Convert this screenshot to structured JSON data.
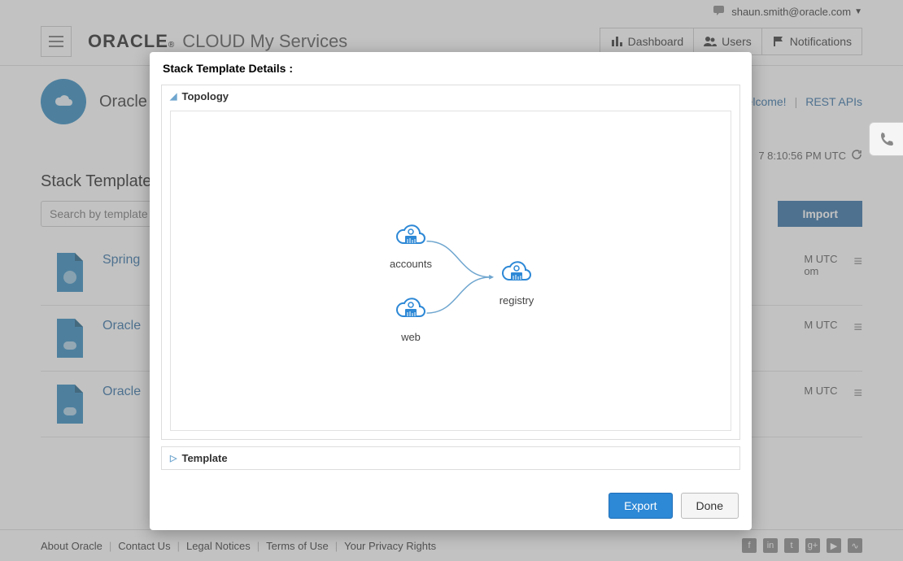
{
  "header": {
    "user_email": "shaun.smith@oracle.com",
    "brand_name": "ORACLE",
    "brand_suffix": "CLOUD My Services",
    "nav": {
      "dashboard": "Dashboard",
      "users": "Users",
      "notifications": "Notifications"
    }
  },
  "page": {
    "badge_title": "Oracle",
    "welcome": "elcome!",
    "rest_apis": "REST APIs",
    "timestamp": "7 8:10:56 PM UTC",
    "section_title": "Stack Templates",
    "search_placeholder": "Search by template n",
    "import_label": "Import"
  },
  "templates": [
    {
      "name": "Spring",
      "meta_line1": "M UTC",
      "meta_line2": "om"
    },
    {
      "name": "Oracle",
      "meta_line1": "M UTC",
      "meta_line2": ""
    },
    {
      "name": "Oracle",
      "meta_line1": "M UTC",
      "meta_line2": ""
    }
  ],
  "footer": {
    "links": [
      "About Oracle",
      "Contact Us",
      "Legal Notices",
      "Terms of Use",
      "Your Privacy Rights"
    ]
  },
  "modal": {
    "title": "Stack Template Details :",
    "topology_label": "Topology",
    "template_label": "Template",
    "export_label": "Export",
    "done_label": "Done",
    "nodes": {
      "accounts": "accounts",
      "web": "web",
      "registry": "registry"
    }
  }
}
